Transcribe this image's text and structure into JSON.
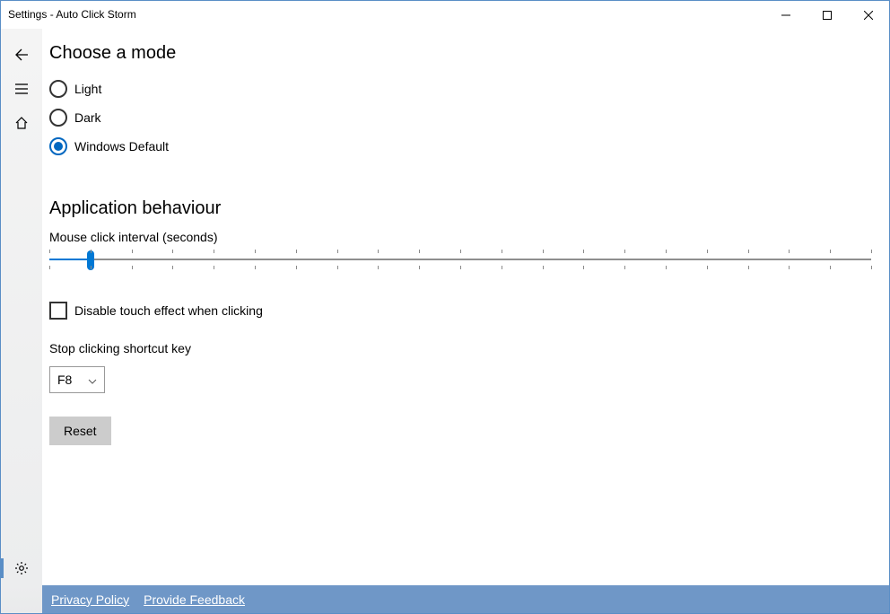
{
  "window": {
    "title": "Settings - Auto Click Storm"
  },
  "mode": {
    "heading": "Choose a mode",
    "options": {
      "light": "Light",
      "dark": "Dark",
      "windows_default": "Windows Default"
    },
    "selected": "windows_default"
  },
  "behaviour": {
    "heading": "Application behaviour",
    "interval_label": "Mouse click interval (seconds)",
    "slider": {
      "min": 0,
      "max": 100,
      "value": 5
    },
    "disable_touch_label": "Disable touch effect when clicking",
    "disable_touch_checked": false,
    "shortcut_label": "Stop clicking shortcut key",
    "shortcut_value": "F8",
    "reset_label": "Reset"
  },
  "footer": {
    "privacy": "Privacy Policy",
    "feedback": "Provide Feedback"
  }
}
